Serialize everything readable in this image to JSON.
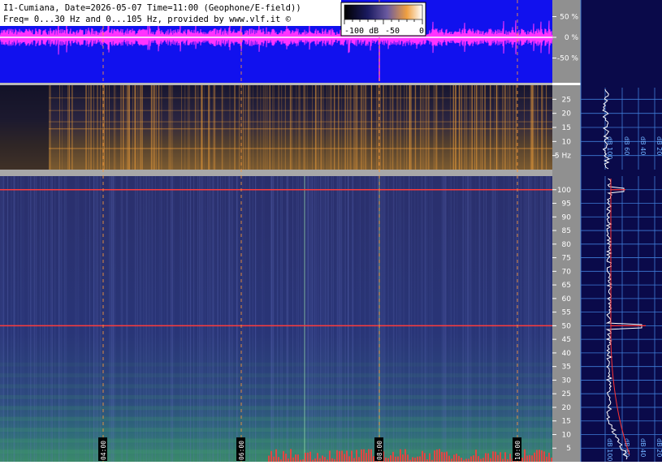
{
  "header": {
    "line1": "I1-Cumiana, Date=2026-05-07 Time=11:00 (Geophone/E-field))",
    "line2": "Freq= 0...30 Hz and 0...105 Hz, provided by www.vlf.it ©"
  },
  "colorbar": {
    "labels": [
      "-100 dB",
      "-50",
      "0"
    ]
  },
  "chart_data": [
    {
      "type": "line",
      "title": "",
      "panel": "waveform",
      "y_tick_labels": [
        "50 %",
        "0 %",
        "-50 %"
      ],
      "y_ticks": [
        50,
        0,
        -50
      ],
      "ylim": [
        -100,
        100
      ],
      "colors": {
        "background": "#1111ee",
        "signal": "#ff33ff",
        "baseline": "#ffffff"
      }
    },
    {
      "type": "heatmap",
      "panel": "spectrogram-low",
      "y_ticks": [
        5,
        10,
        15,
        20,
        25
      ],
      "y_tick_labels": [
        "5 Hz",
        "10",
        "15",
        "20",
        "25"
      ],
      "ylim": [
        0,
        30
      ],
      "xlim_hours": [
        3.0,
        11.0
      ],
      "time_markers": [
        "04:00",
        "06:00",
        "08:00",
        "10:00"
      ],
      "colors": {
        "background": "#14142e",
        "high": "#e89a3a"
      }
    },
    {
      "type": "heatmap",
      "panel": "spectrogram-high",
      "y_ticks": [
        5,
        10,
        15,
        20,
        25,
        30,
        35,
        40,
        45,
        50,
        55,
        60,
        65,
        70,
        75,
        80,
        85,
        90,
        95,
        100
      ],
      "y_tick_labels": [
        "5",
        "10",
        "15",
        "20",
        "25",
        "30",
        "35",
        "40",
        "45",
        "50",
        "55",
        "60",
        "65",
        "70",
        "75",
        "80",
        "85",
        "90",
        "95",
        "100"
      ],
      "ylim": [
        0,
        105
      ],
      "xlim_hours": [
        3.0,
        11.0
      ],
      "time_markers": [
        "04:00",
        "06:00",
        "08:00",
        "10:00"
      ],
      "marked_lines_hz": [
        100,
        50
      ],
      "colors": {
        "background": "#232a66",
        "low_band": "#3f9d6a",
        "line": "#ff3b3b"
      }
    },
    {
      "type": "line",
      "panel": "band-power",
      "x_tick_labels": [
        "dB 100",
        "dB 60",
        "dB 40",
        "dB 20"
      ],
      "colors": {
        "background": "#0a0a4a",
        "trace": "#ffffff",
        "fit": "#ff3333",
        "grid": "#3f7cd8"
      }
    }
  ]
}
